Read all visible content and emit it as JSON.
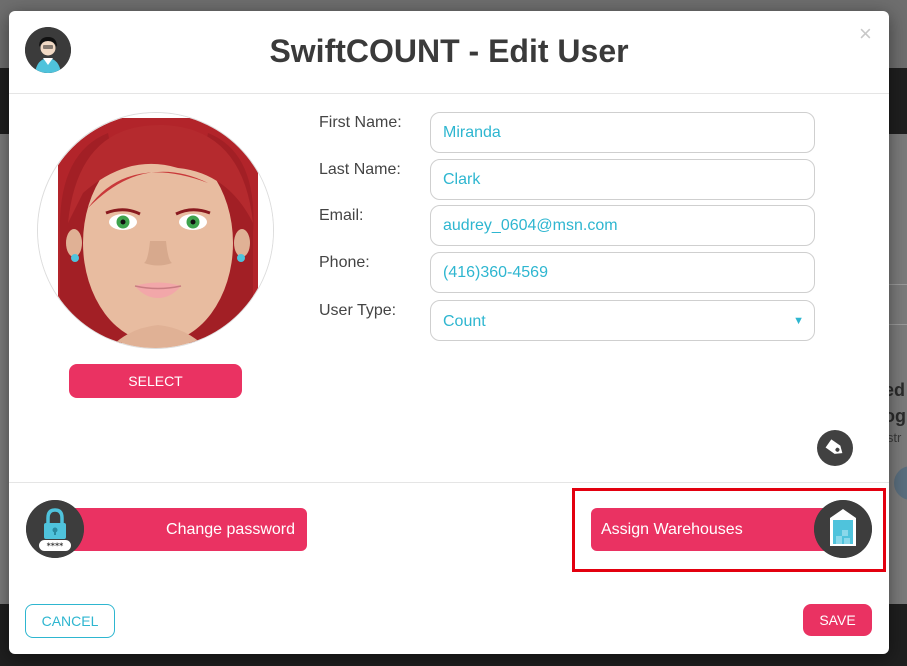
{
  "modal": {
    "title": "SwiftCOUNT - Edit User",
    "close_glyph": "×"
  },
  "profile": {
    "select_label": "SELECT"
  },
  "form": {
    "first_name_label": "First Name:",
    "first_name_value": "Miranda",
    "last_name_label": "Last Name:",
    "last_name_value": "Clark",
    "email_label": "Email:",
    "email_value": "audrey_0604@msn.com",
    "phone_label": "Phone:",
    "phone_value": "(416)360-4569",
    "user_type_label": "User Type:",
    "user_type_value": "Count",
    "user_type_caret": "▼"
  },
  "actions": {
    "change_password_label": "Change password",
    "assign_warehouses_label": "Assign Warehouses",
    "password_mask": "****"
  },
  "footer": {
    "cancel_label": "CANCEL",
    "save_label": "SAVE"
  },
  "background": {
    "fragment_1": "ed",
    "fragment_2": "og",
    "fragment_3": "istr"
  },
  "icons": [
    "user-avatar-icon",
    "close-icon",
    "tag-icon",
    "lock-icon",
    "warehouse-icon",
    "chevron-down-icon"
  ],
  "colors": {
    "accent_pink": "#ea3262",
    "accent_cyan": "#2eb6d0",
    "highlight_red": "#e3000f",
    "title_text": "#3a3a3a"
  }
}
